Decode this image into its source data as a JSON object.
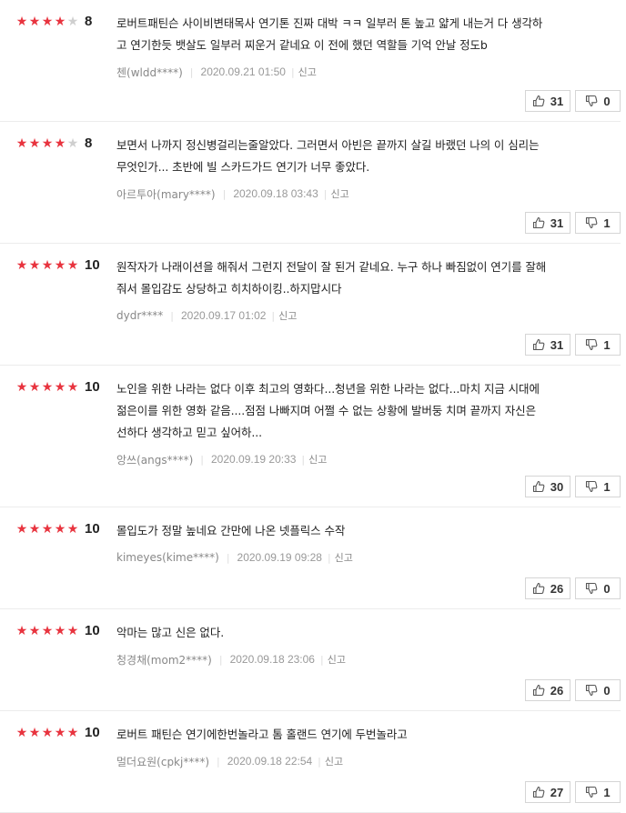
{
  "labels": {
    "report": "신고"
  },
  "icons": {
    "up": "thumbs-up-icon",
    "down": "thumbs-down-icon",
    "star": "star-icon"
  },
  "colors": {
    "star_on": "#e8343f",
    "star_off": "#cfcfcf"
  },
  "reviews": [
    {
      "stars": 4,
      "score": "8",
      "lines": [
        "로버트패틴슨 사이비변태목사 연기톤 진짜 대박 ㅋㅋ 일부러 톤 높고 얇게 내는거 다 생각하",
        "고 연기한듯 뱃살도 일부러 찌운거 같네요 이 전에 했던 역할들 기억 안날 정도b"
      ],
      "user": "첸(wldd****)",
      "date": "2020.09.21 01:50",
      "up": "31",
      "down": "0"
    },
    {
      "stars": 4,
      "score": "8",
      "lines": [
        "보면서 나까지 정신병걸리는줄알았다. 그러면서 아빈은 끝까지 살길 바랬던 나의 이 심리는",
        "무엇인가... 초반에 빌 스카드가드 연기가 너무 좋았다."
      ],
      "user": "아르투아(mary****)",
      "date": "2020.09.18 03:43",
      "up": "31",
      "down": "1"
    },
    {
      "stars": 5,
      "score": "10",
      "lines": [
        "원작자가 나래이션을 해줘서 그런지 전달이 잘 된거 같네요. 누구 하나 빠짐없이 연기를 잘해",
        "줘서 몰입감도 상당하고 히치하이킹..하지맙시다"
      ],
      "user": "dydr****",
      "date": "2020.09.17 01:02",
      "up": "31",
      "down": "1"
    },
    {
      "stars": 5,
      "score": "10",
      "lines": [
        "노인을 위한 나라는 없다 이후 최고의 영화다...청년을 위한 나라는 없다...마치 지금 시대에",
        "젊은이를 위한 영화 같음....점점 나빠지며 어쩔 수 없는 상황에 발버둥 치며 끝까지 자신은",
        "선하다 생각하고 믿고 싶어하..."
      ],
      "user": "앙쓰(angs****)",
      "date": "2020.09.19 20:33",
      "up": "30",
      "down": "1"
    },
    {
      "stars": 5,
      "score": "10",
      "lines": [
        "몰입도가 정말 높네요 간만에 나온 넷플릭스 수작"
      ],
      "user": "kimeyes(kime****)",
      "date": "2020.09.19 09:28",
      "up": "26",
      "down": "0"
    },
    {
      "stars": 5,
      "score": "10",
      "lines": [
        "악마는 많고 신은 없다."
      ],
      "user": "청경채(mom2****)",
      "date": "2020.09.18 23:06",
      "up": "26",
      "down": "0"
    },
    {
      "stars": 5,
      "score": "10",
      "lines": [
        "로버트 패틴슨 연기에한번놀라고 톰 홀랜드 연기에 두번놀라고"
      ],
      "user": "멀더요원(cpkj****)",
      "date": "2020.09.18 22:54",
      "up": "27",
      "down": "1"
    }
  ]
}
